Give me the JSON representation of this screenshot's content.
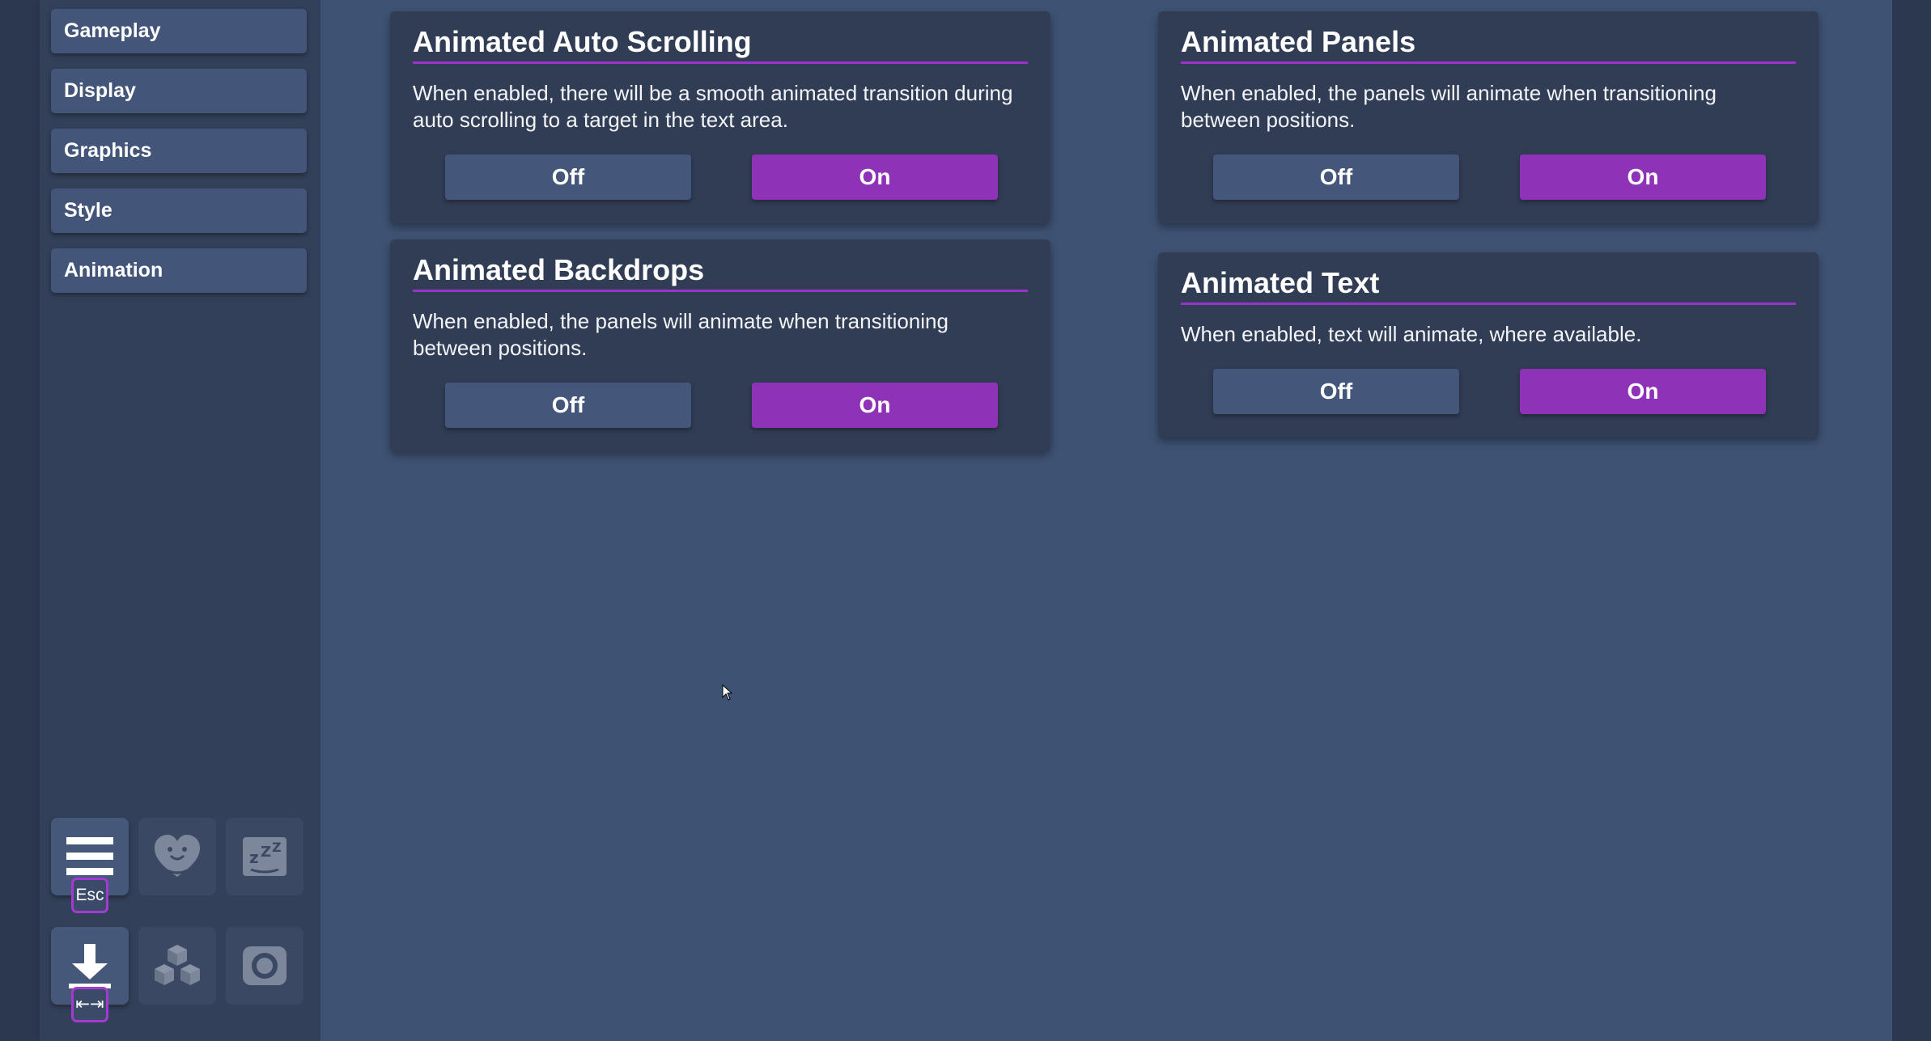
{
  "sidebar": {
    "items": [
      {
        "label": "Gameplay"
      },
      {
        "label": "Display"
      },
      {
        "label": "Graphics"
      },
      {
        "label": "Style"
      },
      {
        "label": "Animation"
      }
    ],
    "quick_buttons": {
      "menu_key": "Esc",
      "save_key": "⇤⇥",
      "icons": [
        "menu-icon",
        "heart-icon",
        "sleep-icon",
        "download-icon",
        "cubes-icon",
        "screenshot-icon"
      ]
    }
  },
  "settings": [
    {
      "title": "Animated Auto Scrolling",
      "description": "When enabled, there will be a smooth animated transition during auto scrolling to a target in the text area.",
      "off_label": "Off",
      "on_label": "On"
    },
    {
      "title": "Animated Panels",
      "description": "When enabled, the panels will animate when transitioning between positions.",
      "off_label": "Off",
      "on_label": "On"
    },
    {
      "title": "Animated Backdrops",
      "description": "When enabled, the panels will animate when transitioning between positions.",
      "off_label": "Off",
      "on_label": "On"
    },
    {
      "title": "Animated Text",
      "description": "When enabled, text will animate, where available.",
      "off_label": "Off",
      "on_label": "On"
    }
  ],
  "colors": {
    "accent": "#8e33b8",
    "button": "#44577a",
    "card": "#313d55",
    "main_bg": "#3e5273"
  }
}
